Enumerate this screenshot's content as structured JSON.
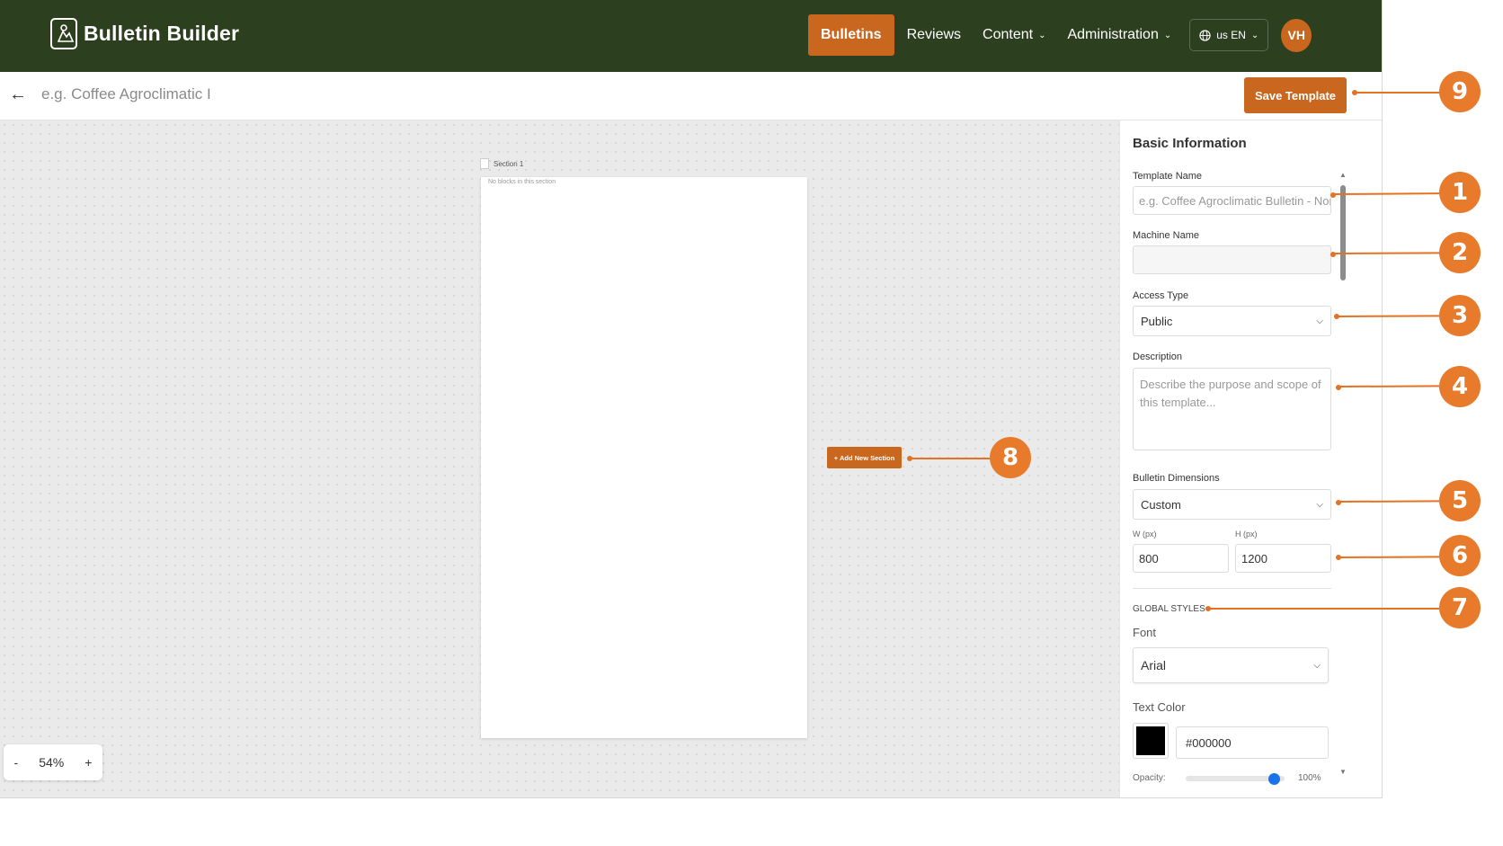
{
  "header": {
    "brand": "Bulletin Builder",
    "nav": [
      {
        "label": "Bulletins",
        "active": true,
        "dropdown": false
      },
      {
        "label": "Reviews",
        "active": false,
        "dropdown": false
      },
      {
        "label": "Content",
        "active": false,
        "dropdown": true
      },
      {
        "label": "Administration",
        "active": false,
        "dropdown": true
      }
    ],
    "language": "us EN",
    "avatar_initials": "VH"
  },
  "subbar": {
    "title_placeholder": "e.g. Coffee Agroclimatic I",
    "save_label": "Save Template"
  },
  "canvas": {
    "section_title": "Section 1",
    "empty_message": "No blocks in this section",
    "add_section_label": "+ Add New Section",
    "zoom": {
      "minus": "-",
      "value": "54%",
      "plus": "+"
    }
  },
  "sidebar": {
    "title": "Basic Information",
    "template_name": {
      "label": "Template Name",
      "placeholder": "e.g. Coffee Agroclimatic Bulletin - North"
    },
    "machine_name": {
      "label": "Machine Name",
      "value": ""
    },
    "access_type": {
      "label": "Access Type",
      "value": "Public"
    },
    "description": {
      "label": "Description",
      "placeholder": "Describe the purpose and scope of this template..."
    },
    "dimensions": {
      "label": "Bulletin Dimensions",
      "value": "Custom",
      "w_label": "W (px)",
      "h_label": "H (px)",
      "w_value": "800",
      "h_value": "1200"
    },
    "global_styles": {
      "heading": "GLOBAL STYLES",
      "font_label": "Font",
      "font_value": "Arial",
      "text_color_label": "Text Color",
      "text_color_value": "#000000",
      "opacity_label": "Opacity:",
      "opacity_value": "100%",
      "opacity_fraction": 0.95
    }
  },
  "callouts": [
    "1",
    "2",
    "3",
    "4",
    "5",
    "6",
    "7",
    "8",
    "9"
  ],
  "colors": {
    "header_bg": "#2c3f1e",
    "accent": "#c9671f",
    "callout": "#e87a2c",
    "swatch": "#000000"
  }
}
